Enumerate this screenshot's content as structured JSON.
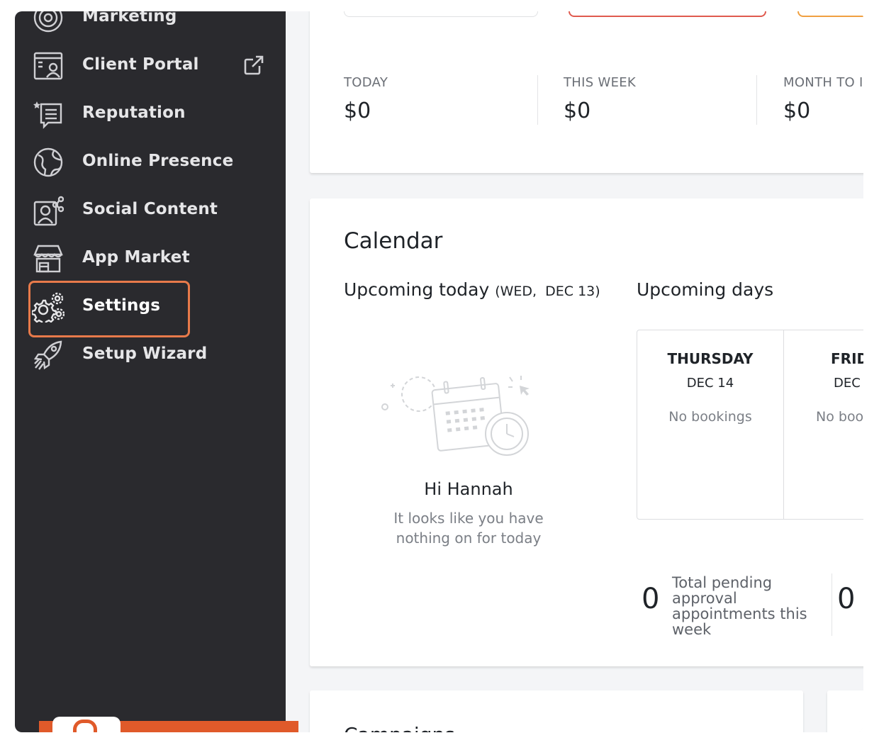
{
  "sidebar": {
    "items": [
      {
        "label": "Marketing",
        "icon": "target-icon"
      },
      {
        "label": "Client Portal",
        "icon": "client-portal-icon"
      },
      {
        "label": "Reputation",
        "icon": "reputation-icon"
      },
      {
        "label": "Online Presence",
        "icon": "globe-icon"
      },
      {
        "label": "Social Content",
        "icon": "social-content-icon"
      },
      {
        "label": "App Market",
        "icon": "store-icon"
      },
      {
        "label": "Settings",
        "icon": "gears-icon"
      },
      {
        "label": "Setup Wizard",
        "icon": "rocket-icon"
      }
    ],
    "external_link_icon": "external-link-icon",
    "active_item": "Settings",
    "highlight_color": "#e87a4a"
  },
  "stats": {
    "today_label": "TODAY",
    "today_value": "$0",
    "week_label": "THIS WEEK",
    "week_value": "$0",
    "month_label": "MONTH TO I",
    "month_value": "$0"
  },
  "calendar": {
    "title": "Calendar",
    "upcoming_today": "Upcoming today",
    "today_date": "(WED,  DEC 13)",
    "upcoming_days": "Upcoming days",
    "greeting": "Hi Hannah",
    "empty_message": "It looks like you have nothing on for today",
    "days": [
      {
        "name": "THURSDAY",
        "date": "DEC 14",
        "bookings": "No bookings"
      },
      {
        "name": "FRID",
        "date": "DEC",
        "bookings": "No boo"
      }
    ],
    "pending_count": "0",
    "pending_text": "Total pending approval appointments this week",
    "second_count": "0"
  },
  "campaigns": {
    "title": "Campaigns"
  },
  "colors": {
    "sidebar_bg": "#2a2a2e",
    "accent_orange": "#e05a2a",
    "card_red_border": "#e05a4e",
    "card_orange_border": "#f0a040"
  }
}
